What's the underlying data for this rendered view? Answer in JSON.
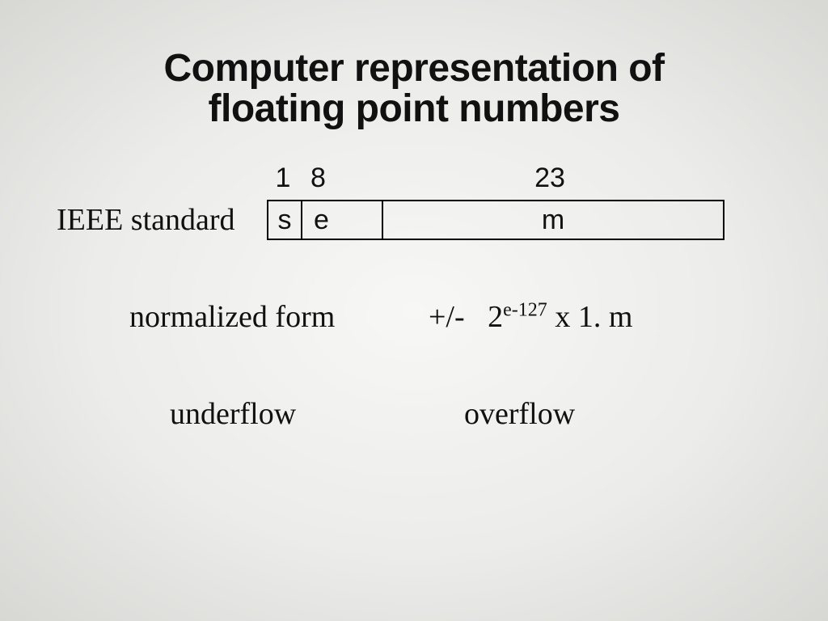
{
  "title_line1": "Computer representation of",
  "title_line2": "floating point numbers",
  "ieee_label": "IEEE standard",
  "bits": {
    "s_count": "1",
    "e_count": "8",
    "m_count": "23",
    "s_label": "s",
    "e_label": "e",
    "m_label": "m"
  },
  "normalized_label": "normalized form",
  "formula": {
    "sign": "+/-",
    "base": "2",
    "exp": "e-127",
    "tail": " x 1. m"
  },
  "underflow": "underflow",
  "overflow": "overflow"
}
